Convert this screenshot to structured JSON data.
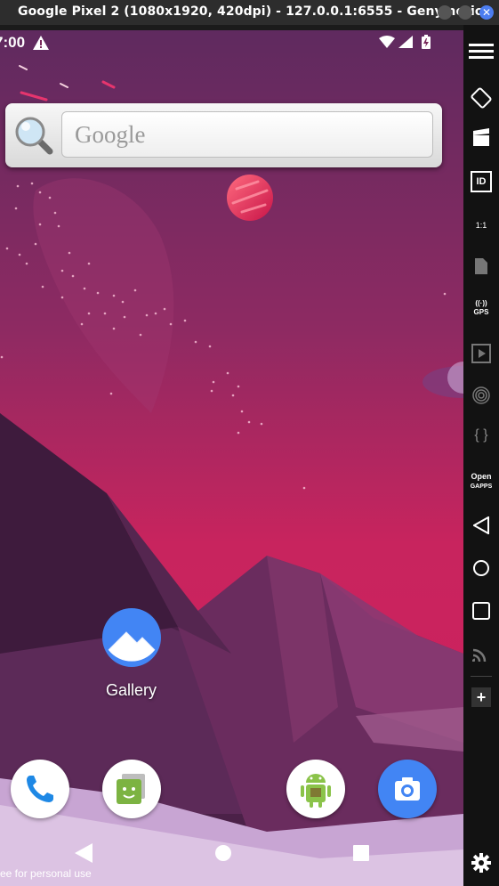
{
  "window": {
    "title": "Google Pixel 2 (1080x1920, 420dpi) - 127.0.0.1:6555 - Genymotion",
    "close_glyph": "✕"
  },
  "status_bar": {
    "time": "7:00"
  },
  "search_widget": {
    "placeholder": "Google"
  },
  "home": {
    "apps": [
      {
        "label": "Gallery",
        "icon": "gallery-icon"
      }
    ]
  },
  "dock": {
    "apps": [
      "phone-icon",
      "messaging-icon",
      "android-app-icon",
      "camera-icon"
    ]
  },
  "watermark": "ee for personal use",
  "sidebar": {
    "items": [
      "menu-icon",
      "rotate-icon",
      "capture-icon",
      "device-id-icon",
      "pixel-perfect-icon",
      "sim-icon",
      "gps-icon",
      "media-icon",
      "fingerprint-icon",
      "shell-icon",
      "opengapps-icon",
      "back-icon",
      "home-icon",
      "recents-icon",
      "cast-icon",
      "add-icon",
      "settings-icon"
    ],
    "pixel_perfect_label": "1:1",
    "gps_label": "GPS",
    "id_label": "ID",
    "shell_label": "{ }",
    "opengapps_line1": "Open",
    "opengapps_line2": "GAPPS",
    "add_label": "+"
  }
}
